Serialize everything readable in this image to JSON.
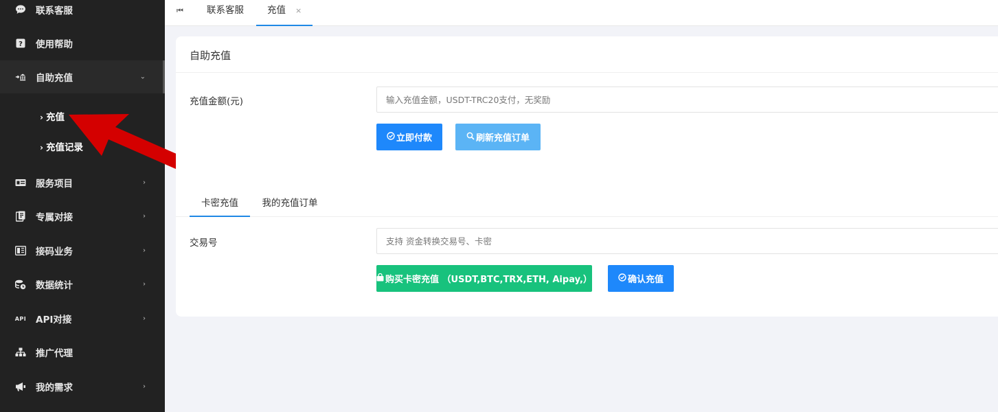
{
  "sidebar": {
    "items": [
      {
        "label": "联系客服",
        "icon": "chat-icon",
        "chevron": false
      },
      {
        "label": "使用帮助",
        "icon": "help-icon",
        "chevron": false
      },
      {
        "label": "自助充值",
        "icon": "recharge-icon",
        "chevron": true,
        "expanded": true
      },
      {
        "label": "服务项目",
        "icon": "service-icon",
        "chevron": true
      },
      {
        "label": "专属对接",
        "icon": "docking-icon",
        "chevron": true
      },
      {
        "label": "接码业务",
        "icon": "code-icon",
        "chevron": true
      },
      {
        "label": "数据统计",
        "icon": "stats-icon",
        "chevron": true
      },
      {
        "label": "API对接",
        "icon": "api-icon",
        "chevron": true
      },
      {
        "label": "推广代理",
        "icon": "sitemap-icon",
        "chevron": false
      },
      {
        "label": "我的需求",
        "icon": "megaphone-icon",
        "chevron": true
      }
    ],
    "sub_items": [
      {
        "label": "充值"
      },
      {
        "label": "充值记录"
      }
    ],
    "api_icon_text": "API"
  },
  "topbar": {
    "tabs": [
      {
        "label": "联系客服"
      },
      {
        "label": "充值",
        "active": true,
        "closable": true
      }
    ],
    "close_glyph": "×"
  },
  "card": {
    "title": "自助充值",
    "amount_label": "充值金额(元)",
    "amount_placeholder": "输入充值金额，USDT-TRC20支付，无奖励",
    "pay_button": "立即付款",
    "refresh_button": "刷新充值订单",
    "tabs": [
      {
        "label": "卡密充值",
        "active": true
      },
      {
        "label": "我的充值订单"
      }
    ],
    "txn_label": "交易号",
    "txn_placeholder": "支持 资金转换交易号、卡密",
    "buy_button": "购买卡密充值 （USDT,BTC,TRX,ETH, Aipay,）",
    "confirm_button": "确认充值"
  },
  "colors": {
    "sidebar_bg": "#222222",
    "primary": "#1e88fb",
    "light_blue": "#5bb4f5",
    "green": "#18c27d",
    "annotation_arrow": "#d40000"
  }
}
